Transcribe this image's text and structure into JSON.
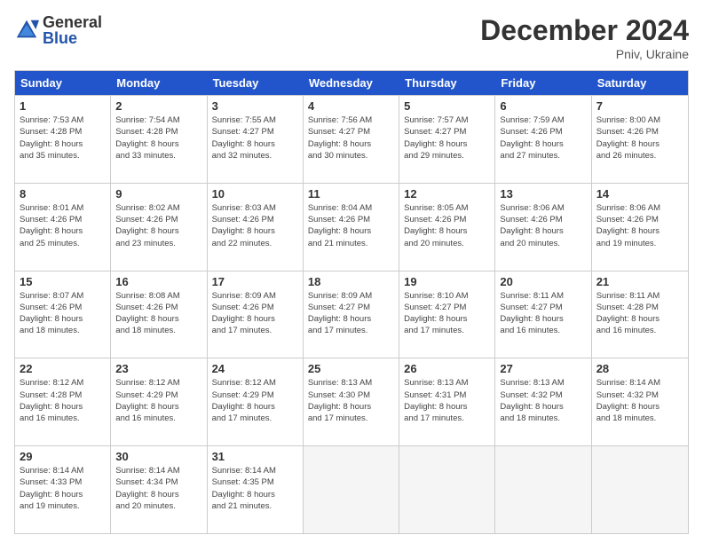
{
  "header": {
    "logo_general": "General",
    "logo_blue": "Blue",
    "month_title": "December 2024",
    "location": "Pniv, Ukraine"
  },
  "days_of_week": [
    "Sunday",
    "Monday",
    "Tuesday",
    "Wednesday",
    "Thursday",
    "Friday",
    "Saturday"
  ],
  "weeks": [
    [
      {
        "day": "1",
        "info": "Sunrise: 7:53 AM\nSunset: 4:28 PM\nDaylight: 8 hours\nand 35 minutes."
      },
      {
        "day": "2",
        "info": "Sunrise: 7:54 AM\nSunset: 4:28 PM\nDaylight: 8 hours\nand 33 minutes."
      },
      {
        "day": "3",
        "info": "Sunrise: 7:55 AM\nSunset: 4:27 PM\nDaylight: 8 hours\nand 32 minutes."
      },
      {
        "day": "4",
        "info": "Sunrise: 7:56 AM\nSunset: 4:27 PM\nDaylight: 8 hours\nand 30 minutes."
      },
      {
        "day": "5",
        "info": "Sunrise: 7:57 AM\nSunset: 4:27 PM\nDaylight: 8 hours\nand 29 minutes."
      },
      {
        "day": "6",
        "info": "Sunrise: 7:59 AM\nSunset: 4:26 PM\nDaylight: 8 hours\nand 27 minutes."
      },
      {
        "day": "7",
        "info": "Sunrise: 8:00 AM\nSunset: 4:26 PM\nDaylight: 8 hours\nand 26 minutes."
      }
    ],
    [
      {
        "day": "8",
        "info": "Sunrise: 8:01 AM\nSunset: 4:26 PM\nDaylight: 8 hours\nand 25 minutes."
      },
      {
        "day": "9",
        "info": "Sunrise: 8:02 AM\nSunset: 4:26 PM\nDaylight: 8 hours\nand 23 minutes."
      },
      {
        "day": "10",
        "info": "Sunrise: 8:03 AM\nSunset: 4:26 PM\nDaylight: 8 hours\nand 22 minutes."
      },
      {
        "day": "11",
        "info": "Sunrise: 8:04 AM\nSunset: 4:26 PM\nDaylight: 8 hours\nand 21 minutes."
      },
      {
        "day": "12",
        "info": "Sunrise: 8:05 AM\nSunset: 4:26 PM\nDaylight: 8 hours\nand 20 minutes."
      },
      {
        "day": "13",
        "info": "Sunrise: 8:06 AM\nSunset: 4:26 PM\nDaylight: 8 hours\nand 20 minutes."
      },
      {
        "day": "14",
        "info": "Sunrise: 8:06 AM\nSunset: 4:26 PM\nDaylight: 8 hours\nand 19 minutes."
      }
    ],
    [
      {
        "day": "15",
        "info": "Sunrise: 8:07 AM\nSunset: 4:26 PM\nDaylight: 8 hours\nand 18 minutes."
      },
      {
        "day": "16",
        "info": "Sunrise: 8:08 AM\nSunset: 4:26 PM\nDaylight: 8 hours\nand 18 minutes."
      },
      {
        "day": "17",
        "info": "Sunrise: 8:09 AM\nSunset: 4:26 PM\nDaylight: 8 hours\nand 17 minutes."
      },
      {
        "day": "18",
        "info": "Sunrise: 8:09 AM\nSunset: 4:27 PM\nDaylight: 8 hours\nand 17 minutes."
      },
      {
        "day": "19",
        "info": "Sunrise: 8:10 AM\nSunset: 4:27 PM\nDaylight: 8 hours\nand 17 minutes."
      },
      {
        "day": "20",
        "info": "Sunrise: 8:11 AM\nSunset: 4:27 PM\nDaylight: 8 hours\nand 16 minutes."
      },
      {
        "day": "21",
        "info": "Sunrise: 8:11 AM\nSunset: 4:28 PM\nDaylight: 8 hours\nand 16 minutes."
      }
    ],
    [
      {
        "day": "22",
        "info": "Sunrise: 8:12 AM\nSunset: 4:28 PM\nDaylight: 8 hours\nand 16 minutes."
      },
      {
        "day": "23",
        "info": "Sunrise: 8:12 AM\nSunset: 4:29 PM\nDaylight: 8 hours\nand 16 minutes."
      },
      {
        "day": "24",
        "info": "Sunrise: 8:12 AM\nSunset: 4:29 PM\nDaylight: 8 hours\nand 17 minutes."
      },
      {
        "day": "25",
        "info": "Sunrise: 8:13 AM\nSunset: 4:30 PM\nDaylight: 8 hours\nand 17 minutes."
      },
      {
        "day": "26",
        "info": "Sunrise: 8:13 AM\nSunset: 4:31 PM\nDaylight: 8 hours\nand 17 minutes."
      },
      {
        "day": "27",
        "info": "Sunrise: 8:13 AM\nSunset: 4:32 PM\nDaylight: 8 hours\nand 18 minutes."
      },
      {
        "day": "28",
        "info": "Sunrise: 8:14 AM\nSunset: 4:32 PM\nDaylight: 8 hours\nand 18 minutes."
      }
    ],
    [
      {
        "day": "29",
        "info": "Sunrise: 8:14 AM\nSunset: 4:33 PM\nDaylight: 8 hours\nand 19 minutes."
      },
      {
        "day": "30",
        "info": "Sunrise: 8:14 AM\nSunset: 4:34 PM\nDaylight: 8 hours\nand 20 minutes."
      },
      {
        "day": "31",
        "info": "Sunrise: 8:14 AM\nSunset: 4:35 PM\nDaylight: 8 hours\nand 21 minutes."
      },
      {
        "day": "",
        "info": ""
      },
      {
        "day": "",
        "info": ""
      },
      {
        "day": "",
        "info": ""
      },
      {
        "day": "",
        "info": ""
      }
    ]
  ]
}
